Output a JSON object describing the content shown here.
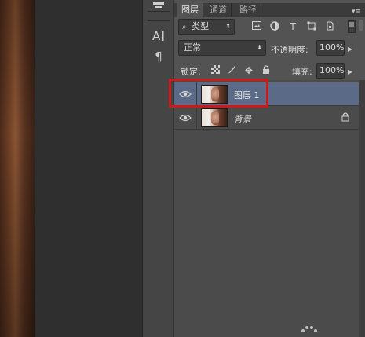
{
  "canvas": {
    "photo_description_icon": "photo-canvas"
  },
  "tool_strip": {
    "tools": [
      {
        "name": "brush-settings-icon",
        "glyph": "⚟"
      },
      {
        "name": "character-icon",
        "glyph": "A|"
      },
      {
        "name": "paragraph-icon",
        "glyph": "¶"
      }
    ]
  },
  "layers_panel": {
    "tabs": [
      {
        "label": "图层",
        "active": true
      },
      {
        "label": "通道",
        "active": false
      },
      {
        "label": "路径",
        "active": false
      }
    ],
    "filter": {
      "kind_label": "类型"
    },
    "blend_mode": "正常",
    "opacity_label": "不透明度:",
    "opacity_value": "100%",
    "lock_label": "锁定:",
    "fill_label": "填充:",
    "fill_value": "100%",
    "layers": [
      {
        "name": "图层 1",
        "selected": true,
        "locked": false,
        "italic": false
      },
      {
        "name": "背景",
        "selected": false,
        "locked": true,
        "italic": true
      }
    ]
  },
  "colors": {
    "highlight": "#d01818",
    "selected_row": "#5a6a87"
  }
}
